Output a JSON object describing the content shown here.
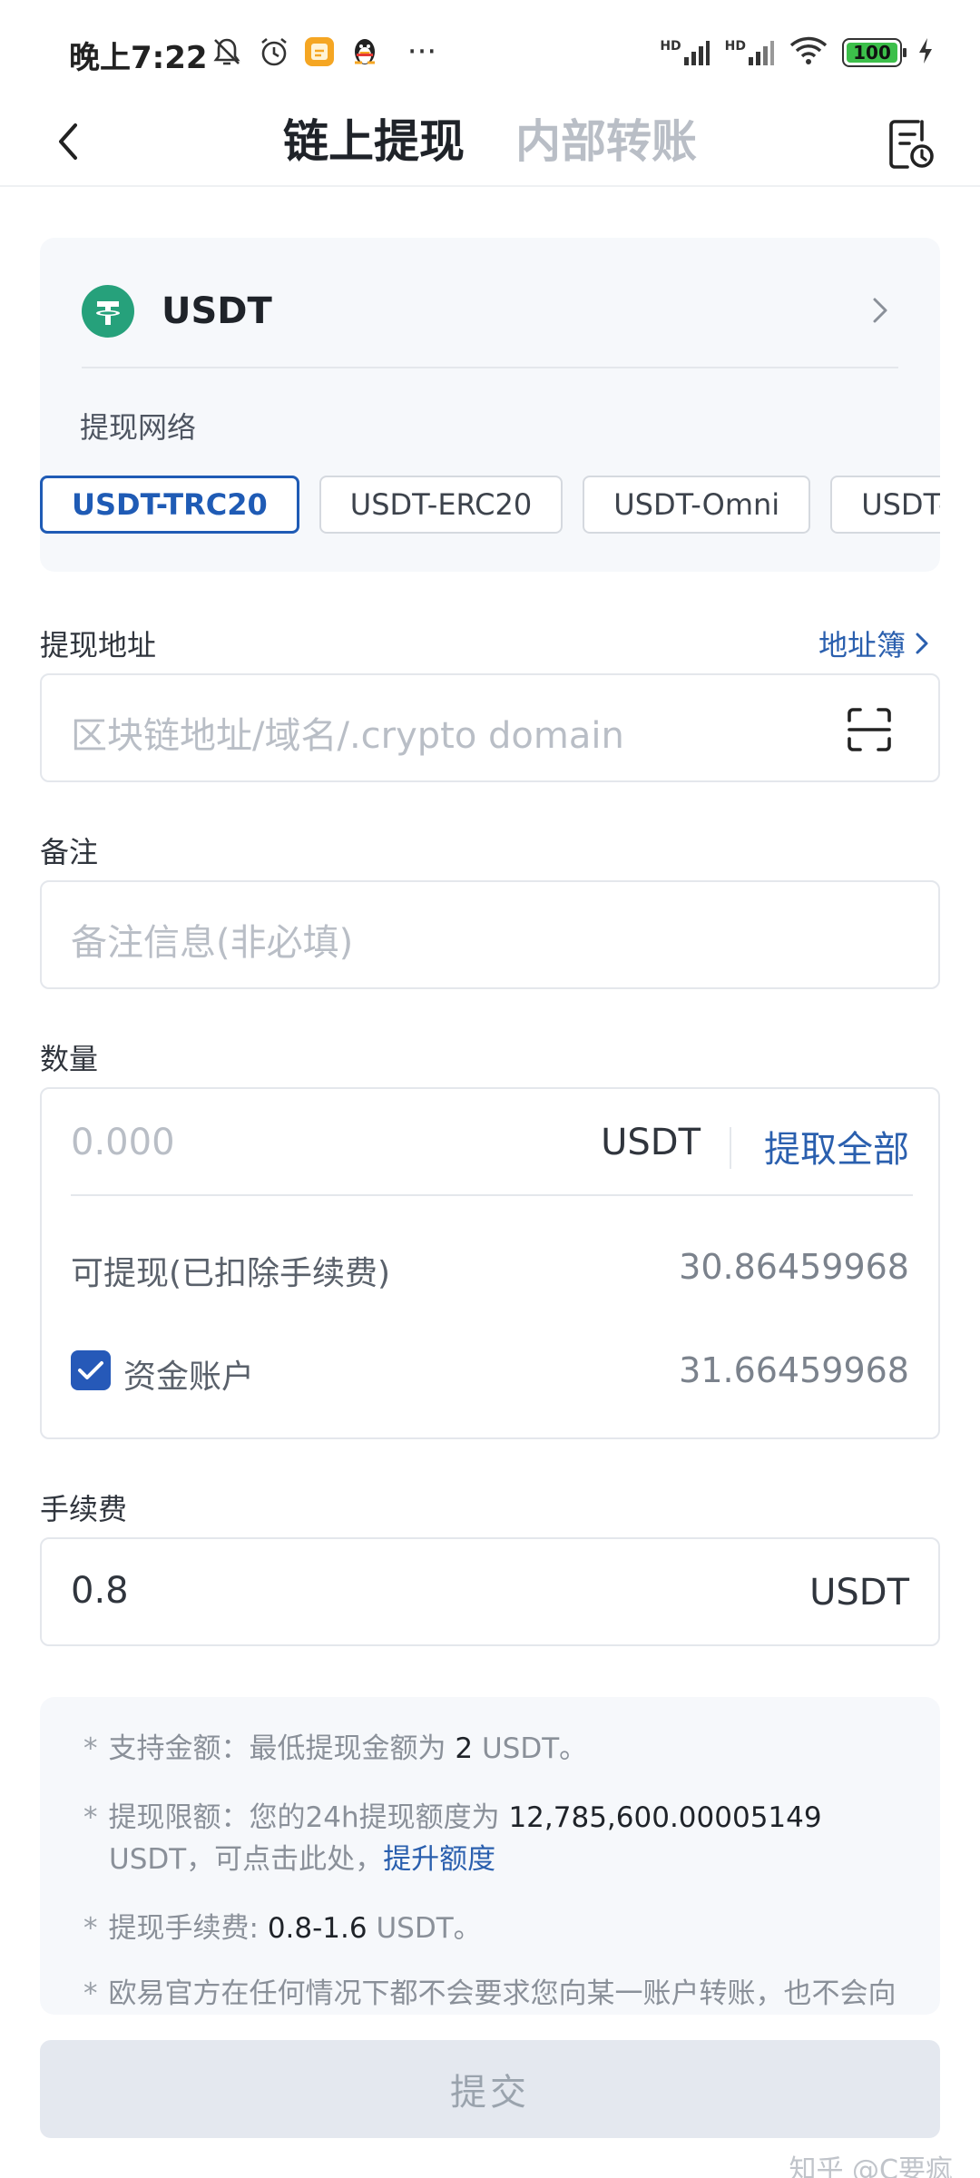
{
  "status_bar": {
    "time": "晚上7:22",
    "battery": "100",
    "network_label_1": "HD",
    "network_label_2": "HD",
    "more": "···"
  },
  "header": {
    "tab_active": "链上提现",
    "tab_inactive": "内部转账"
  },
  "coin": {
    "name": "USDT",
    "network_label": "提现网络",
    "networks": [
      "USDT-TRC20",
      "USDT-ERC20",
      "USDT-Omni",
      "USDT-Algorand"
    ],
    "selected_network": "USDT-TRC20",
    "brand_color": "#26a17b"
  },
  "address": {
    "label": "提现地址",
    "book_link": "地址簿",
    "placeholder": "区块链地址/域名/.crypto domain"
  },
  "memo": {
    "label": "备注",
    "placeholder": "备注信息(非必填)"
  },
  "amount": {
    "label": "数量",
    "placeholder": "0.000",
    "unit": "USDT",
    "withdraw_all": "提取全部",
    "available_label": "可提现(已扣除手续费)",
    "available_value": "30.86459968",
    "funding_label": "资金账户",
    "funding_value": "31.66459968",
    "funding_checked": true
  },
  "fee": {
    "label": "手续费",
    "value": "0.8",
    "unit": "USDT"
  },
  "notes": {
    "n1_prefix": "支持金额：最低提现金额为",
    "n1_value": "2",
    "n1_suffix": "USDT。",
    "n2_prefix": "提现限额：您的24h提现额度为",
    "n2_value": "12,785,600.00005149",
    "n2_line2": "USDT，可点击此处，",
    "n2_link": "提升额度",
    "n3_prefix": "提现手续费:",
    "n3_value": "0.8-1.6",
    "n3_suffix": "USDT。",
    "n4_text": "欧易官方在任何情况下都不会要求您向某一账户转账，也不会向您索要验证码。"
  },
  "submit_label": "提交",
  "watermark": "知乎 @C要疯",
  "colors": {
    "accent": "#2a5fae",
    "active_chip": "#1f5bb5",
    "checkbox": "#2659b8"
  }
}
